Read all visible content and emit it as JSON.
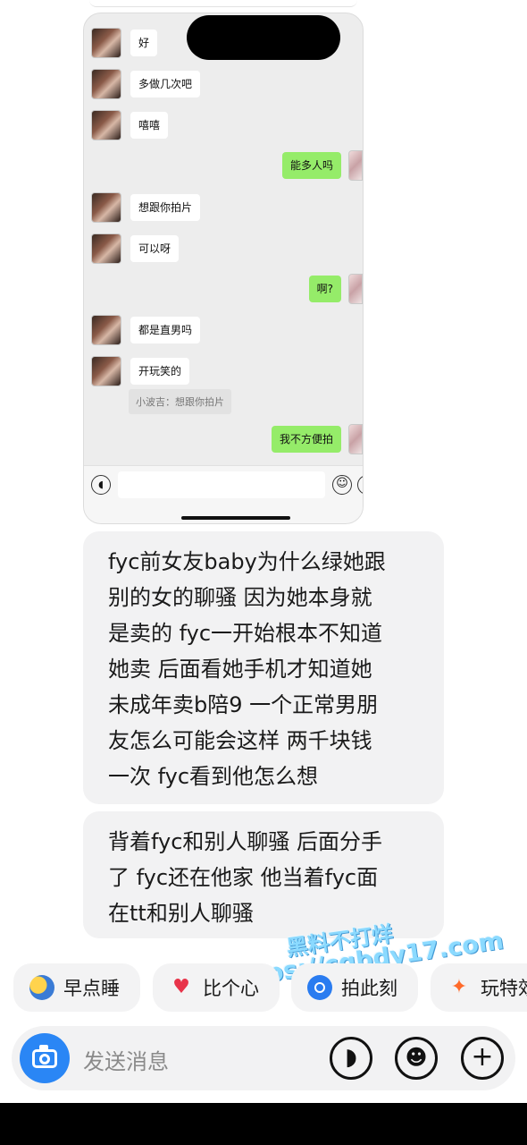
{
  "screenshot": {
    "chat_messages": [
      {
        "side": "left",
        "text": "好"
      },
      {
        "side": "left",
        "text": "多做几次吧"
      },
      {
        "side": "left",
        "text": "嘻嘻"
      },
      {
        "side": "right",
        "text": "能多人吗"
      },
      {
        "side": "left",
        "text": "想跟你拍片"
      },
      {
        "side": "left",
        "text": "可以呀"
      },
      {
        "side": "right",
        "text": "啊?"
      },
      {
        "side": "left",
        "text": "都是直男吗"
      },
      {
        "side": "left",
        "text": "开玩笑的"
      },
      {
        "side": "right",
        "text": "我不方便拍"
      }
    ],
    "quote": "小波吉：想跟你拍片"
  },
  "messages": [
    {
      "text": "fyc前女友baby为什么绿她跟\n别的女的聊骚 因为她本身就\n是卖的 fyc一开始根本不知道\n她卖 后面看她手机才知道她\n未成年卖b陪9 一个正常男朋\n友怎么可能会这样 两千块钱\n一次 fyc看到他怎么想"
    },
    {
      "text": "背着fyc和别人聊骚 后面分手\n了 fyc还在他家 他当着fyc面\n在tt和别人聊骚"
    }
  ],
  "watermark": {
    "line1": "黑料不打烊",
    "line2": "https://cgbdy17.com"
  },
  "quick_replies": [
    {
      "label": "早点睡",
      "icon": "moon-icon"
    },
    {
      "label": "比个心",
      "icon": "heart-icon"
    },
    {
      "label": "拍此刻",
      "icon": "camera-icon"
    },
    {
      "label": "玩特效",
      "icon": "sparkle-icon"
    }
  ],
  "input": {
    "placeholder": "发送消息"
  },
  "colors": {
    "accent": "#2a86f5",
    "sent_bubble": "#95ec69",
    "message_bg": "#f2f2f3"
  }
}
